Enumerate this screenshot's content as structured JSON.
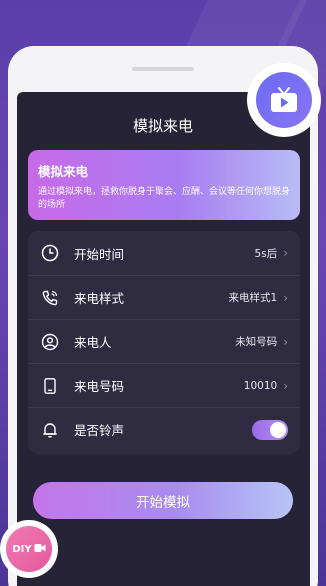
{
  "screen": {
    "title": "模拟来电"
  },
  "banner": {
    "title": "模拟来电",
    "description": "通过模拟来电，拯救你脱身于聚会、应酬、会议等任何你想脱身的场所"
  },
  "settings": {
    "items": [
      {
        "label": "开始时间",
        "value": "5s后",
        "icon": "clock-icon"
      },
      {
        "label": "来电样式",
        "value": "来电样式1",
        "icon": "phone-call-icon"
      },
      {
        "label": "来电人",
        "value": "未知号码",
        "icon": "person-icon"
      },
      {
        "label": "来电号码",
        "value": "10010",
        "icon": "mobile-phone-icon"
      },
      {
        "label": "是否铃声",
        "value": true,
        "icon": "bell-icon"
      }
    ]
  },
  "start_button": {
    "label": "开始模拟"
  },
  "badges": {
    "diy": {
      "label": "DIY",
      "icon": "video-camera-icon"
    },
    "tv": {
      "icon": "tv-play-icon"
    }
  },
  "colors": {
    "background": "#5b3fa8",
    "screen": "#262336",
    "card": "#2f2c42",
    "accent_start": "#c576ea",
    "accent_end": "#b8c4f6"
  }
}
